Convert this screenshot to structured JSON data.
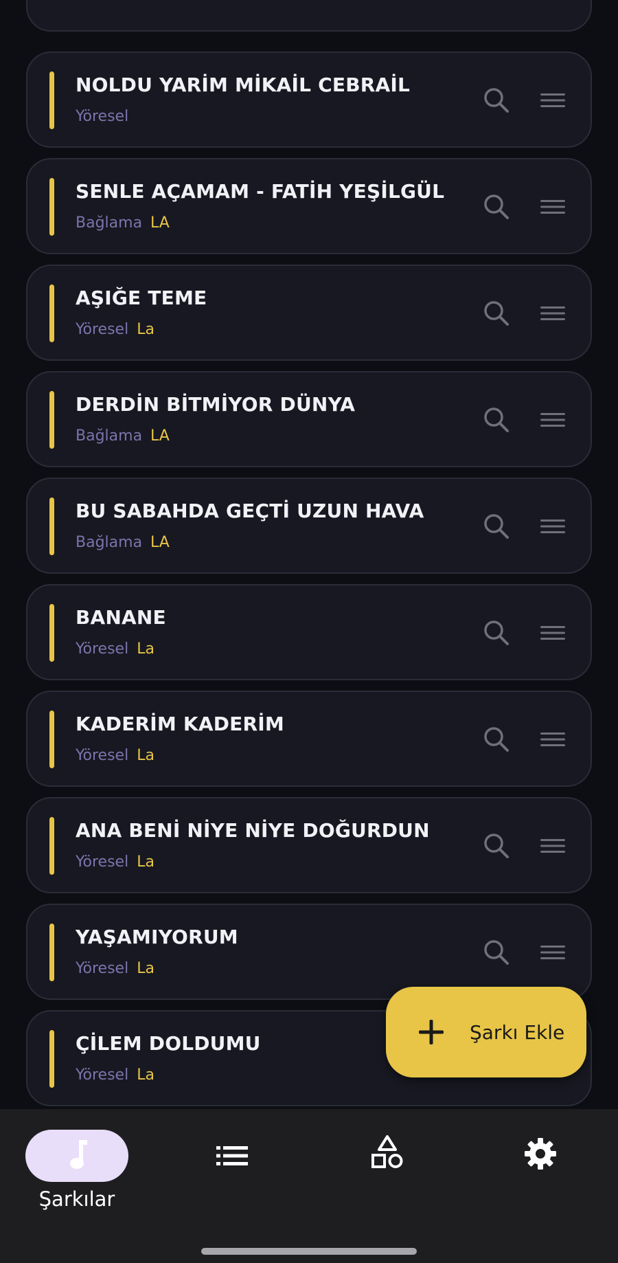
{
  "songs": [
    {
      "title": "NOLDU YARİM MİKAİL CEBRAİL",
      "genre": "Yöresel",
      "key": ""
    },
    {
      "title": "SENLE AÇAMAM - FATİH YEŞİLGÜL",
      "genre": "Bağlama",
      "key": "LA"
    },
    {
      "title": "AŞIĞE TEME",
      "genre": "Yöresel",
      "key": "La"
    },
    {
      "title": "DERDİN BİTMİYOR DÜNYA",
      "genre": "Bağlama",
      "key": "LA"
    },
    {
      "title": "BU SABAHDA GEÇTİ UZUN HAVA",
      "genre": "Bağlama",
      "key": "LA"
    },
    {
      "title": "BANANE",
      "genre": "Yöresel",
      "key": "La"
    },
    {
      "title": "KADERİM KADERİM",
      "genre": "Yöresel",
      "key": "La"
    },
    {
      "title": "ANA BENİ NİYE NİYE DOĞURDUN",
      "genre": "Yöresel",
      "key": "La"
    },
    {
      "title": "YAŞAMIYORUM",
      "genre": "Yöresel",
      "key": "La"
    },
    {
      "title": "ÇİLEM DOLDUMU",
      "genre": "Yöresel",
      "key": "La"
    }
  ],
  "fab": {
    "label": "Şarkı Ekle",
    "icon": "plus-icon"
  },
  "nav": {
    "items": [
      {
        "label": "Şarkılar",
        "icon": "music-note-icon",
        "active": true
      },
      {
        "label": "",
        "icon": "list-icon",
        "active": false
      },
      {
        "label": "",
        "icon": "shapes-icon",
        "active": false
      },
      {
        "label": "",
        "icon": "gear-icon",
        "active": false
      }
    ]
  },
  "colors": {
    "background": "#0d0e13",
    "card": "#171821",
    "accent": "#e8c547",
    "genre_text": "#7b74ad",
    "nav_pill": "#e8defa",
    "nav_bg": "#1e1e20"
  }
}
